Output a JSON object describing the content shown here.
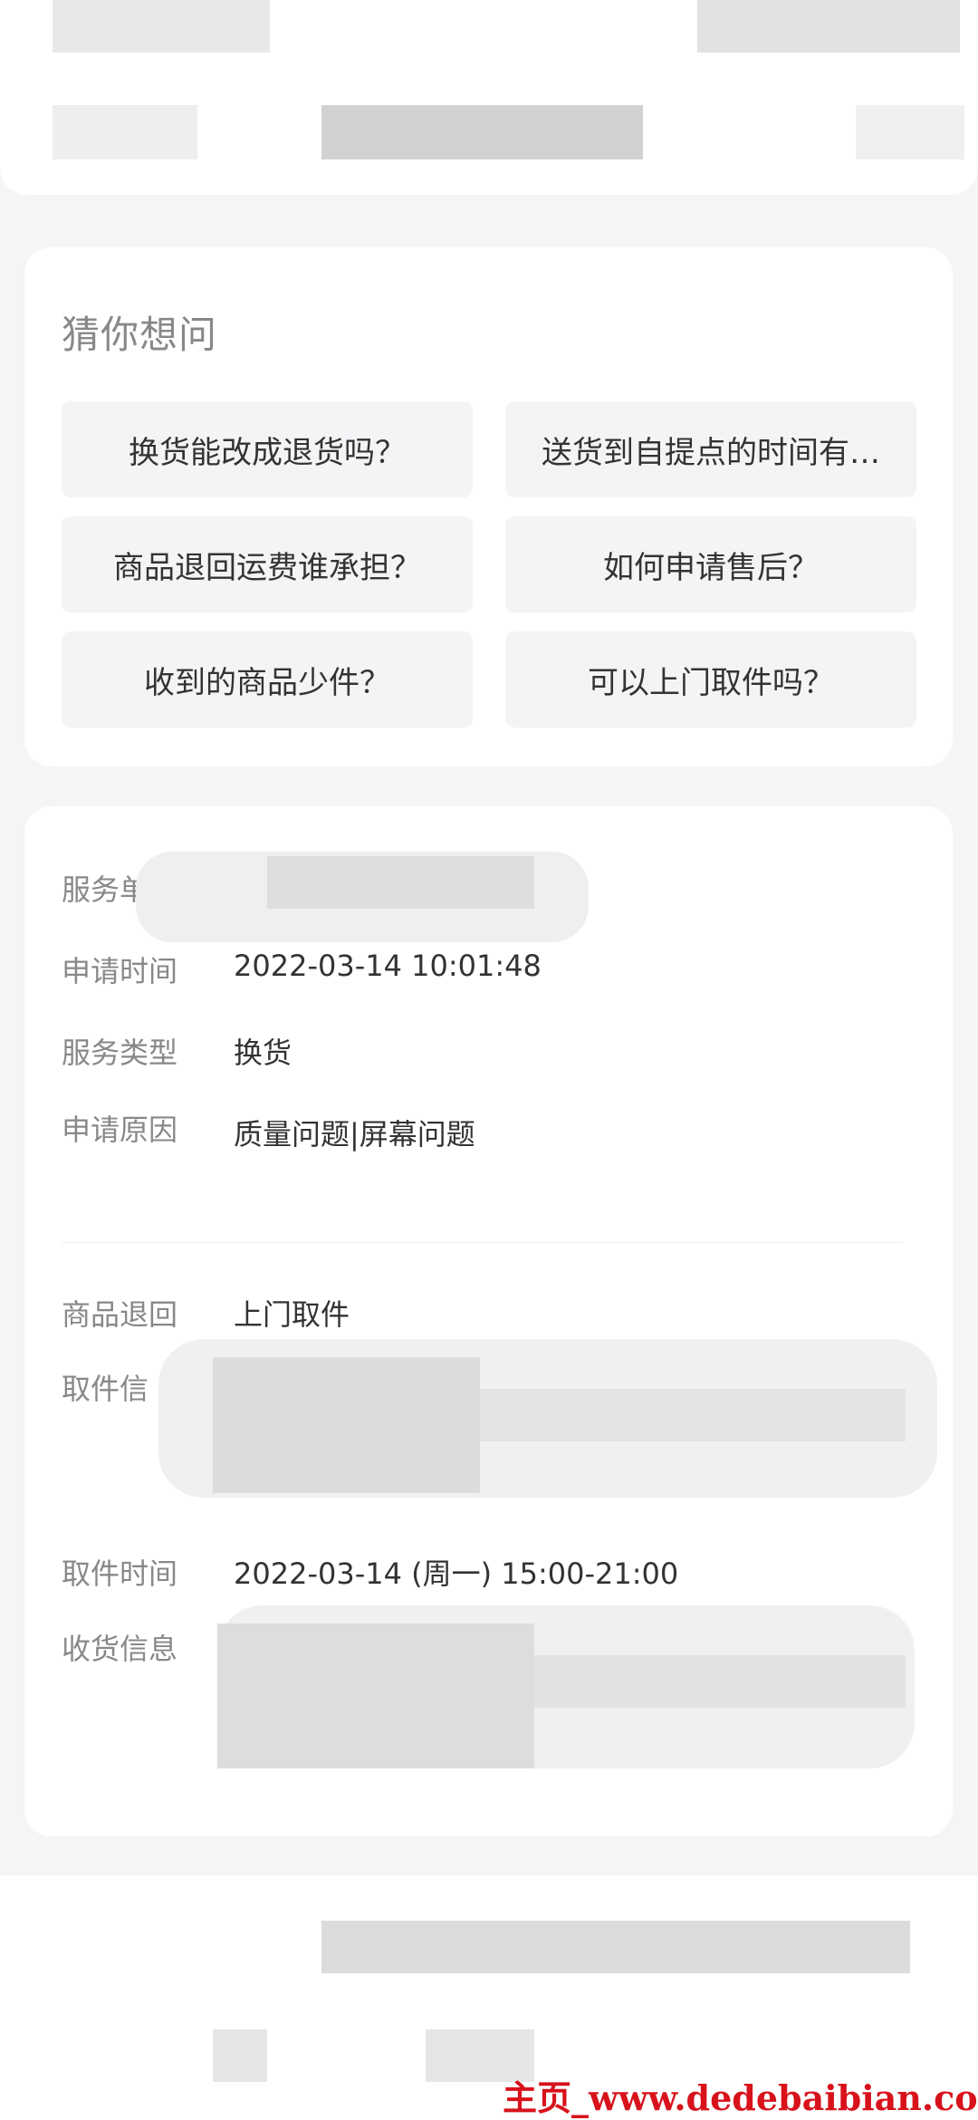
{
  "faq": {
    "title": "猜你想问",
    "questions": [
      "换货能改成退货吗？",
      "送货到自提点的时间有…",
      "商品退回运费谁承担？",
      "如何申请售后？",
      "收到的商品少件？",
      "可以上门取件吗？"
    ]
  },
  "info": {
    "service_no_label": "服务单",
    "apply_time_label": "申请时间",
    "apply_time_value": "2022-03-14 10:01:48",
    "service_type_label": "服务类型",
    "service_type_value": "换货",
    "apply_reason_label": "申请原因",
    "apply_reason_value": "质量问题|屏幕问题",
    "return_label": "商品退回",
    "return_value": "上门取件",
    "pickup_info_label": "取件信",
    "pickup_time_label": "取件时间",
    "pickup_time_value": "2022-03-14 (周一) 15:00-21:00",
    "receive_info_label": "收货信息"
  },
  "watermark": "主页_www.dedebaibian.com"
}
